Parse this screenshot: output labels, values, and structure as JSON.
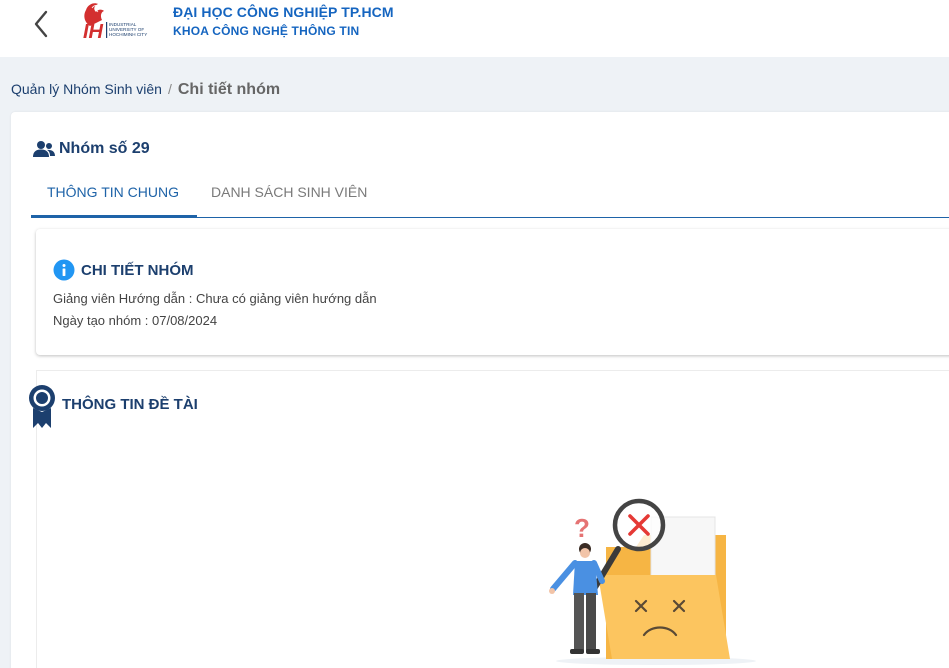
{
  "header": {
    "org_title": "ĐẠI HỌC CÔNG NGHIỆP TP.HCM",
    "org_subtitle": "KHOA CÔNG NGHỆ THÔNG TIN",
    "logo": {
      "letters": "IH",
      "text_lines": [
        "INDUSTRIAL",
        "UNIVERSITY OF",
        "HOCHIMINH CITY"
      ]
    },
    "back_icon": "chevron-left-icon"
  },
  "breadcrumb": {
    "parent": "Quản lý Nhóm Sinh viên",
    "separator": "/",
    "current": "Chi tiết nhóm"
  },
  "group": {
    "title": "Nhóm số 29",
    "icon": "users-icon"
  },
  "tabs": [
    {
      "label": "THÔNG TIN CHUNG",
      "active": true
    },
    {
      "label": "DANH SÁCH SINH VIÊN",
      "active": false
    }
  ],
  "detail": {
    "title": "CHI TIẾT NHÓM",
    "icon": "info-circle-icon",
    "advisor_line": "Giảng viên Hướng dẫn : Chưa có giảng viên hướng dẫn",
    "created_line": "Ngày tạo nhóm : 07/08/2024"
  },
  "topic": {
    "title": "THÔNG TIN ĐỀ TÀI",
    "icon": "award-ribbon-icon",
    "empty_state_icon": "empty-folder-illustration"
  },
  "colors": {
    "primary": "#1e63a8",
    "heading": "#1c3f6e",
    "accent_red": "#e53935",
    "folder": "#fcc55f",
    "background": "#eef2f6"
  }
}
